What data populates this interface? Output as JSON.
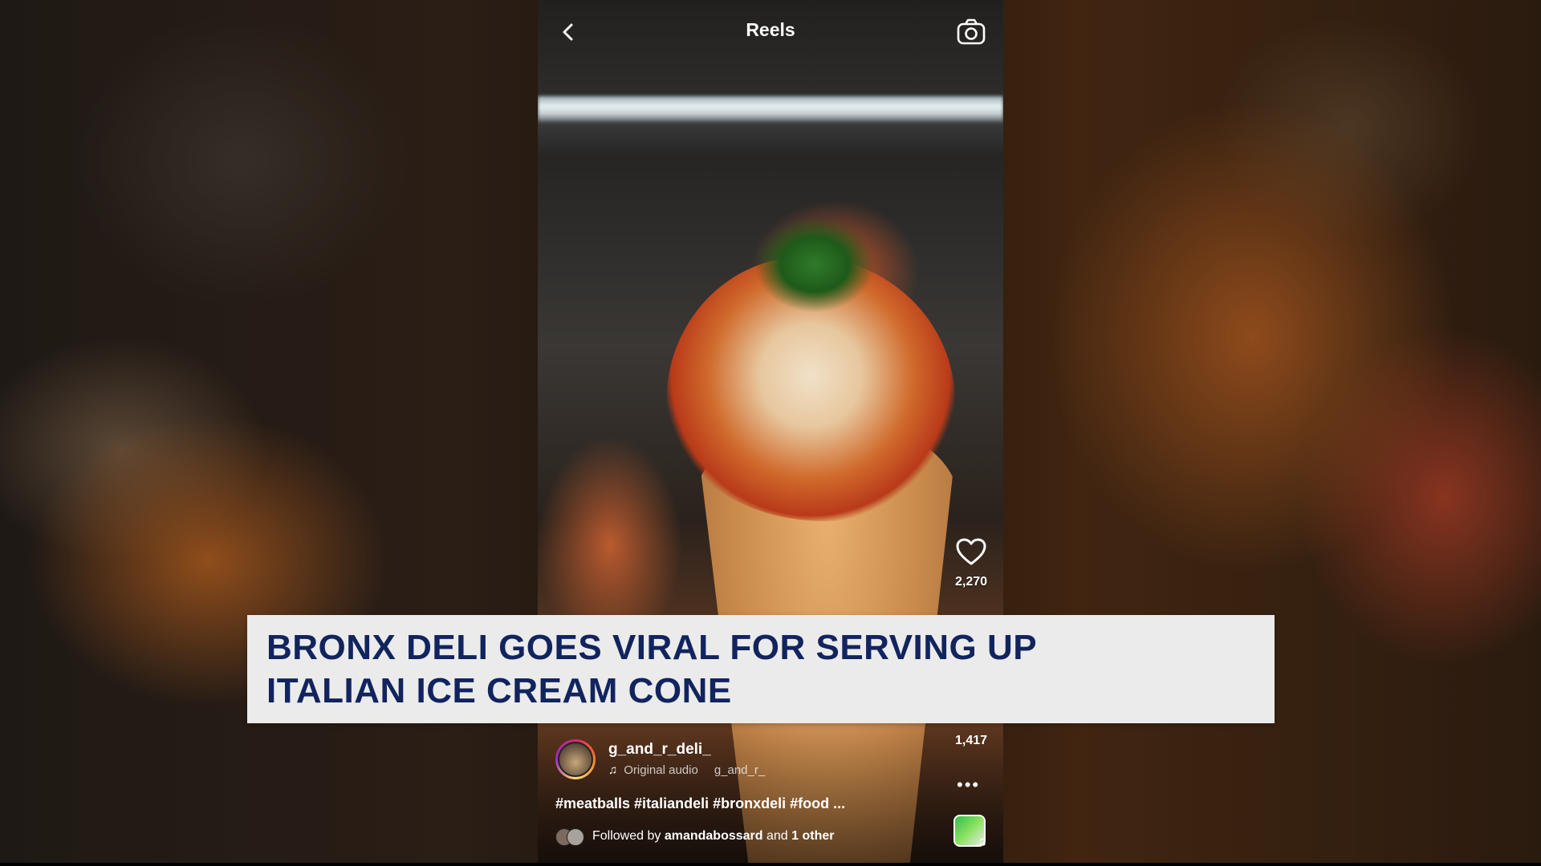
{
  "reel": {
    "title": "Reels",
    "like_count": "2,270",
    "comment_count": "1,417",
    "username": "g_and_r_deli_",
    "audio_label": "Original audio",
    "audio_owner": "g_and_r_",
    "caption": "#meatballs #italiandeli #bronxdeli #food ...",
    "followed_by_prefix": "Followed by",
    "followed_by_user": "amandabossard",
    "followed_by_and": "and",
    "followed_by_other": "1 other"
  },
  "banner": {
    "headline_line1": "BRONX DELI GOES VIRAL FOR SERVING UP",
    "headline_line2": "ITALIAN ICE CREAM CONE"
  },
  "colors": {
    "banner_bg": "#ebebeb",
    "headline_text": "#11245e",
    "ui_text": "#ffffff"
  },
  "icons": [
    "back-icon",
    "camera-icon",
    "heart-icon",
    "music-icon",
    "more-icon",
    "music-badge-icon"
  ]
}
